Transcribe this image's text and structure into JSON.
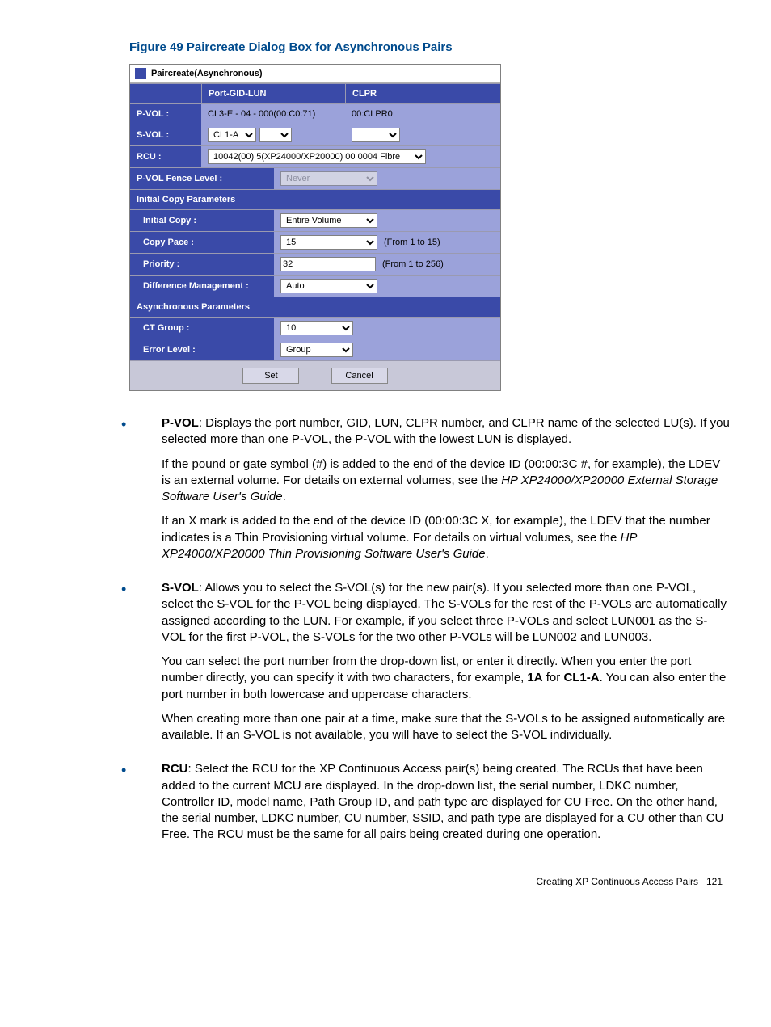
{
  "figure_caption": "Figure 49 Paircreate Dialog Box for Asynchronous Pairs",
  "dialog": {
    "title": "Paircreate(Asynchronous)",
    "header": {
      "col1": "Port-GID-LUN",
      "col2": "CLPR"
    },
    "pvol": {
      "label": "P-VOL :",
      "port": "CL3-E - 04 - 000(00:C0:71)",
      "clpr": "00:CLPR0"
    },
    "svol": {
      "label": "S-VOL :",
      "sel1": "CL1-A"
    },
    "rcu": {
      "label": "RCU :",
      "value": "10042(00) 5(XP24000/XP20000) 00 0004 Fibre"
    },
    "fence": {
      "label": "P-VOL Fence Level :",
      "value": "Never"
    },
    "section_initial": "Initial Copy Parameters",
    "initial_copy": {
      "label": "Initial Copy :",
      "value": "Entire Volume"
    },
    "copy_pace": {
      "label": "Copy Pace :",
      "value": "15",
      "range": "(From 1 to 15)"
    },
    "priority": {
      "label": "Priority :",
      "value": "32",
      "range": "(From 1 to 256)"
    },
    "diff": {
      "label": "Difference Management :",
      "value": "Auto"
    },
    "section_async": "Asynchronous Parameters",
    "ct_group": {
      "label": "CT Group :",
      "value": "10"
    },
    "error_level": {
      "label": "Error Level :",
      "value": "Group"
    },
    "buttons": {
      "set": "Set",
      "cancel": "Cancel"
    }
  },
  "list": {
    "pvol_b": "P-VOL",
    "pvol_1": ": Displays the port number, GID, LUN, CLPR number, and CLPR name of the selected LU(s). If you selected more than one P-VOL, the P-VOL with the lowest LUN is displayed.",
    "pvol_2a": "If the pound or gate symbol (#) is added to the end of the device ID (00:00:3C #, for example), the LDEV is an external volume. For details on external volumes, see the ",
    "pvol_2i": "HP XP24000/XP20000 External Storage Software User's Guide",
    "pvol_2b": ".",
    "pvol_3a": "If an X mark is added to the end of the device ID (00:00:3C X, for example), the LDEV that the number indicates is a Thin Provisioning virtual volume. For details on virtual volumes, see the ",
    "pvol_3i": "HP XP24000/XP20000 Thin Provisioning Software User's Guide",
    "pvol_3b": ".",
    "svol_b": "S-VOL",
    "svol_1": ": Allows you to select the S-VOL(s) for the new pair(s). If you selected more than one P-VOL, select the S-VOL for the P-VOL being displayed. The S-VOLs for the rest of the P-VOLs are automatically assigned according to the LUN. For example, if you select three P-VOLs and select LUN001 as the S-VOL for the first P-VOL, the S-VOLs for the two other P-VOLs will be LUN002 and LUN003.",
    "svol_2a": "You can select the port number from the drop-down list, or enter it directly. When you enter the port number directly, you can specify it with two characters, for example, ",
    "svol_2b1": "1A",
    "svol_2c": " for ",
    "svol_2b2": "CL1-A",
    "svol_2d": ". You can also enter the port number in both lowercase and uppercase characters.",
    "svol_3": "When creating more than one pair at a time, make sure that the S-VOLs to be assigned automatically are available. If an S-VOL is not available, you will have to select the S-VOL individually.",
    "rcu_b": "RCU",
    "rcu_1": ": Select the RCU for the XP Continuous Access pair(s) being created. The RCUs that have been added to the current MCU are displayed. In the drop-down list, the serial number, LDKC number, Controller ID, model name, Path Group ID, and path type are displayed for CU Free. On the other hand, the serial number, LDKC number, CU number, SSID, and path type are displayed for a CU other than CU Free. The RCU must be the same for all pairs being created during one operation."
  },
  "footer": {
    "text": "Creating XP Continuous Access Pairs",
    "page": "121"
  }
}
